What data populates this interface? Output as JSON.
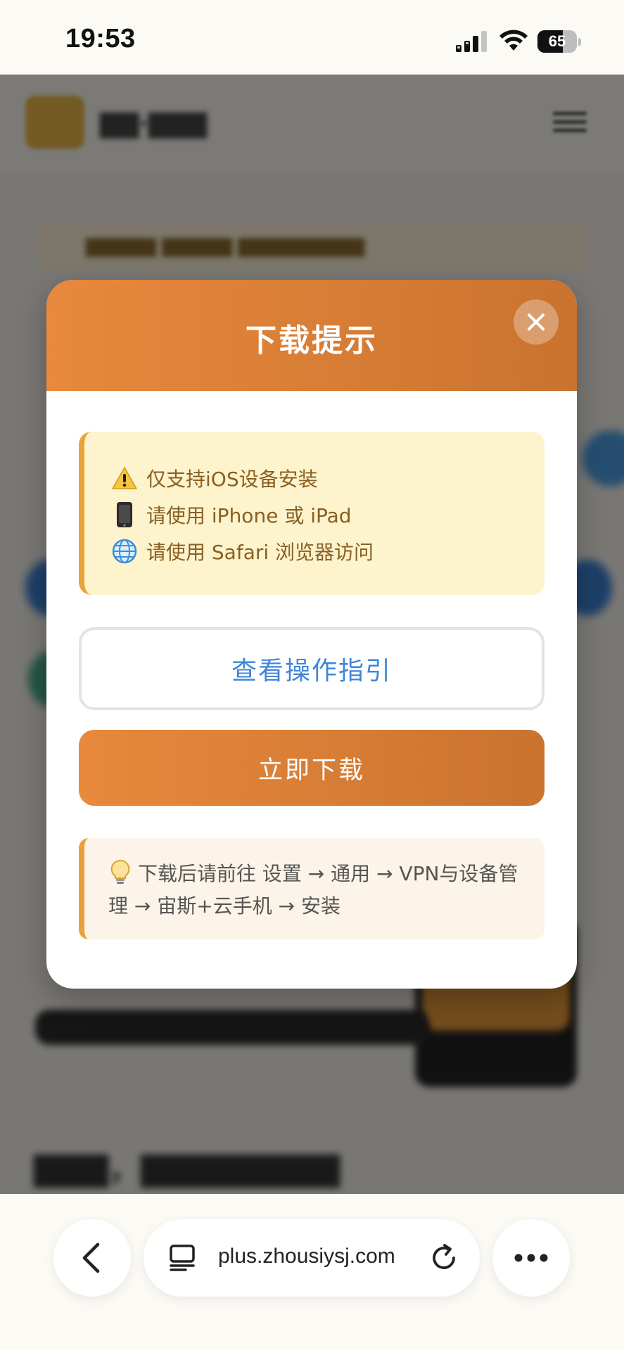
{
  "status_bar": {
    "time": "19:53",
    "battery_level": "65",
    "battery_fraction": 0.65
  },
  "modal": {
    "title": "下载提示",
    "info_lines": [
      {
        "icon": "warning-icon",
        "text": "仅支持iOS设备安装"
      },
      {
        "icon": "mobile-phone-icon",
        "text": "请使用 iPhone 或 iPad"
      },
      {
        "icon": "globe-icon",
        "text": "请使用 Safari 浏览器访问"
      }
    ],
    "guide_button_label": "查看操作指引",
    "download_button_label": "立即下载",
    "tip_text": "下载后请前往 设置 → 通用 → VPN与设备管理 → 宙斯+云手机 → 安装"
  },
  "browser": {
    "url": "plus.zhousiysj.com"
  },
  "colors": {
    "accent_orange": "#e8893c",
    "accent_orange_dark": "#c9732f",
    "link_blue": "#3f86d9",
    "info_bg": "#fdf3cc",
    "info_text": "#8a5f22"
  }
}
